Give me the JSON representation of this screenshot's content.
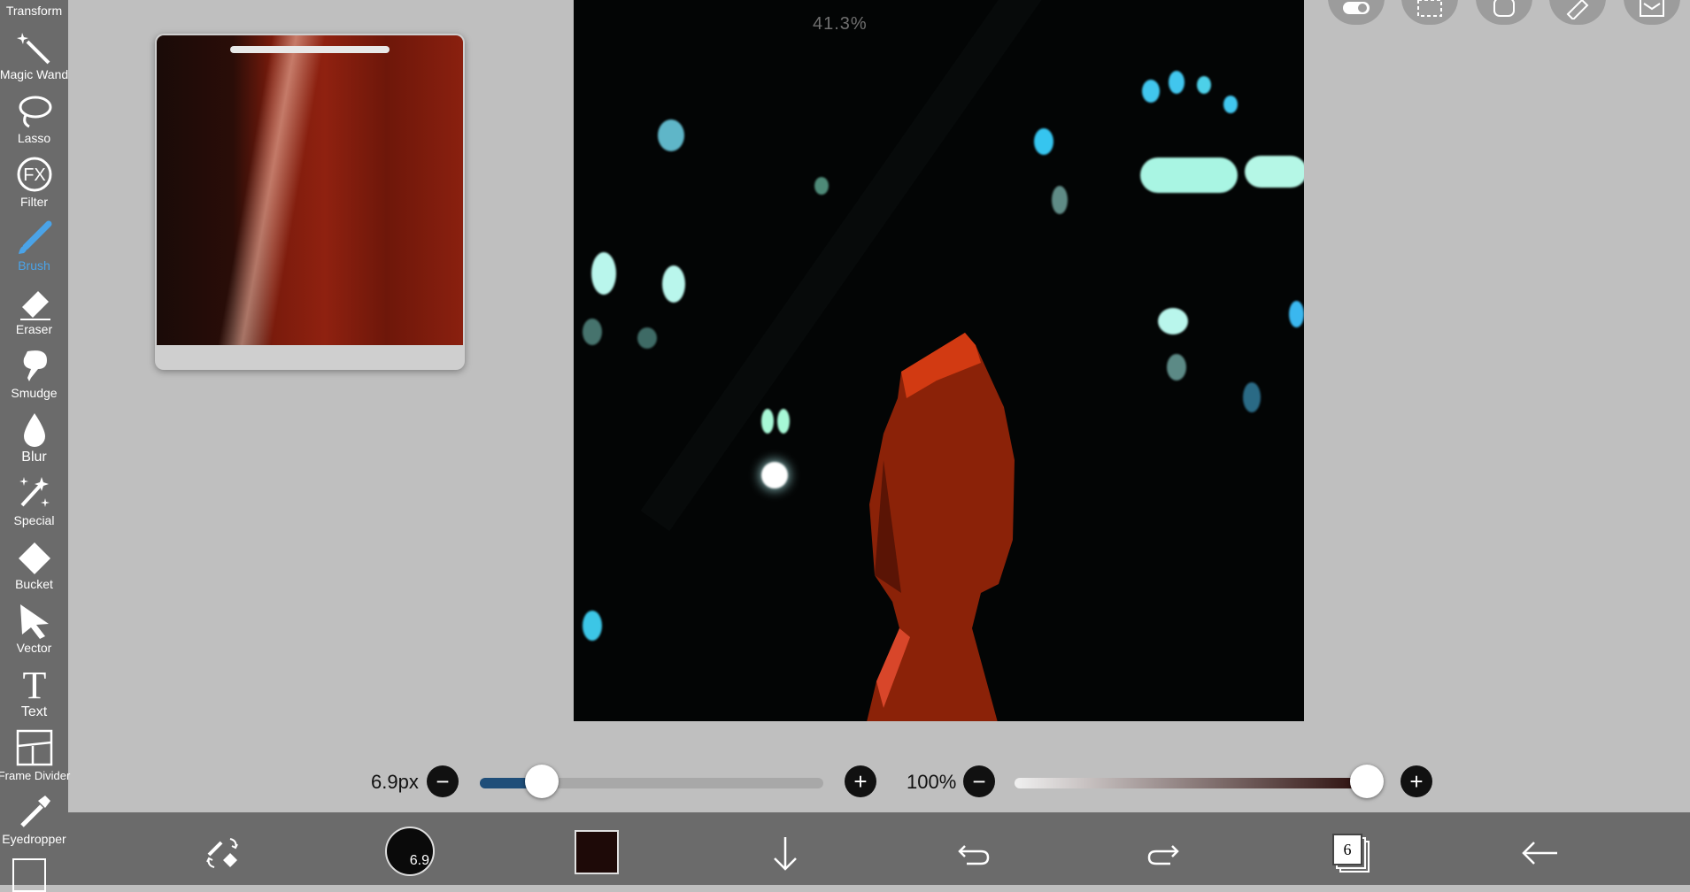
{
  "sidebar": {
    "items": [
      {
        "label": "Transform",
        "icon": "transform-icon"
      },
      {
        "label": "Magic Wand",
        "icon": "magic-wand-icon"
      },
      {
        "label": "Lasso",
        "icon": "lasso-icon"
      },
      {
        "label": "Filter",
        "icon": "fx-icon"
      },
      {
        "label": "Brush",
        "icon": "brush-icon",
        "active": true
      },
      {
        "label": "Eraser",
        "icon": "eraser-icon"
      },
      {
        "label": "Smudge",
        "icon": "smudge-icon"
      },
      {
        "label": "Blur",
        "icon": "blur-drop-icon"
      },
      {
        "label": "Special",
        "icon": "special-icon"
      },
      {
        "label": "Bucket",
        "icon": "bucket-icon"
      },
      {
        "label": "Vector",
        "icon": "vector-arrow-icon"
      },
      {
        "label": "Text",
        "icon": "text-icon"
      },
      {
        "label": "Frame Divider",
        "icon": "frame-divider-icon"
      },
      {
        "label": "Eyedropper",
        "icon": "eyedropper-icon"
      }
    ],
    "active_color": "#4aa3e8"
  },
  "canvas": {
    "zoom_label": "41.3%"
  },
  "brush_size": {
    "label": "6.9px",
    "value_fraction": 0.18,
    "minus": "−",
    "plus": "+"
  },
  "opacity": {
    "label": "100%",
    "value_fraction": 1.0,
    "minus": "−",
    "plus": "+"
  },
  "bottom_toolbar": {
    "brush_preview_size": "6.9",
    "current_color": "#1e0a08",
    "layers_count": "6"
  },
  "colors": {
    "sidebar_bg": "#6b6b6b",
    "workspace_bg": "#bfbfbf",
    "slider_fill": "#1f4e79"
  }
}
